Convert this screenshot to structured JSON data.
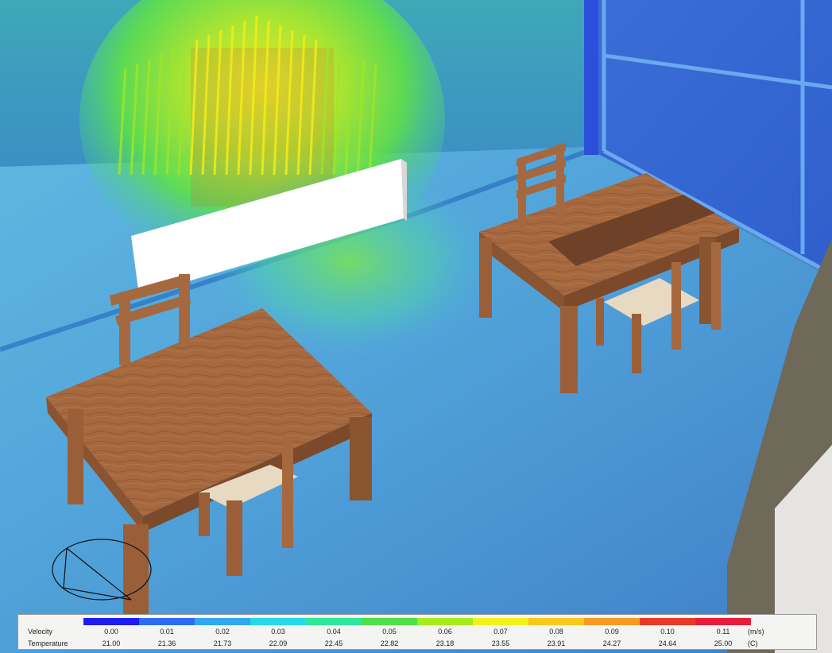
{
  "legend": {
    "velocity_label": "Velocity",
    "temperature_label": "Temperature",
    "velocity_unit": "(m/s)",
    "temperature_unit": "(C)",
    "velocity_values": [
      "0.00",
      "0.01",
      "0.02",
      "0.03",
      "0.04",
      "0.05",
      "0.06",
      "0.07",
      "0.08",
      "0.09",
      "0.10",
      "0.11"
    ],
    "temperature_values": [
      "21.00",
      "21.36",
      "21.73",
      "22.09",
      "22.45",
      "22.82",
      "23.18",
      "23.55",
      "23.91",
      "24.27",
      "24.64",
      "25.00"
    ],
    "colors": [
      "#1c1cf0",
      "#2d6cf2",
      "#2fa8f0",
      "#27d9e8",
      "#2ee89a",
      "#4ee04a",
      "#a7ec1c",
      "#f2f21a",
      "#f8c81a",
      "#f79a22",
      "#ea3a25",
      "#ea1c3a"
    ]
  }
}
